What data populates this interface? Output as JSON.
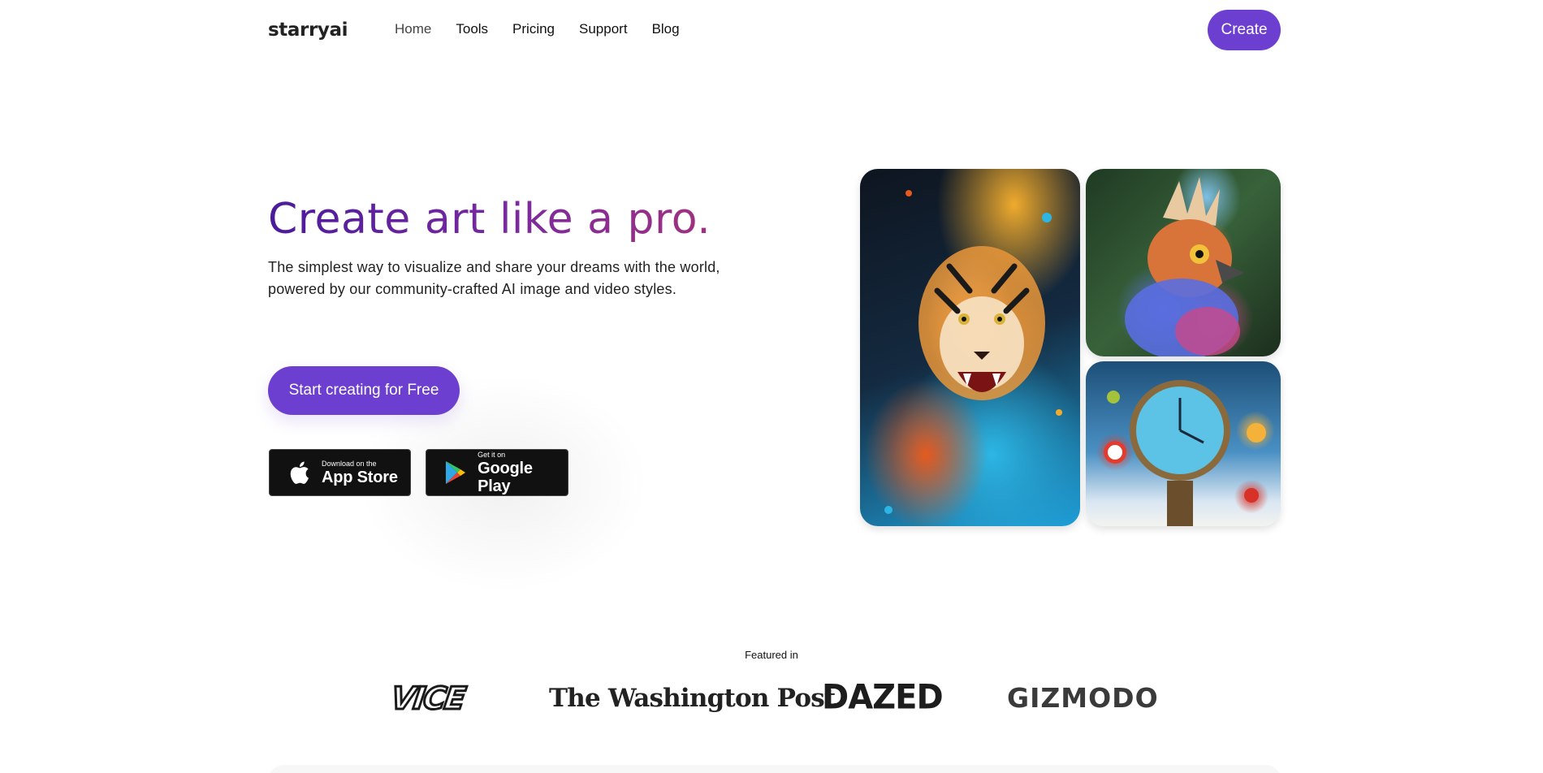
{
  "nav": {
    "logo": "starryai",
    "links": [
      "Home",
      "Tools",
      "Pricing",
      "Support",
      "Blog"
    ],
    "create_label": "Create"
  },
  "hero": {
    "title": "Create art like a pro.",
    "description": "The simplest way to visualize and share your dreams with the world, powered by our community-crafted AI image and video styles.",
    "cta_label": "Start creating for Free"
  },
  "stores": {
    "apple_small": "Download on the",
    "apple_big": "App Store",
    "google_small": "Get it on",
    "google_big": "Google Play"
  },
  "featured": {
    "label": "Featured in",
    "logos": [
      "VICE",
      "The Washington Post",
      "DAZED",
      "GIZMODO"
    ]
  },
  "colors": {
    "accent": "#6d3fd0"
  }
}
